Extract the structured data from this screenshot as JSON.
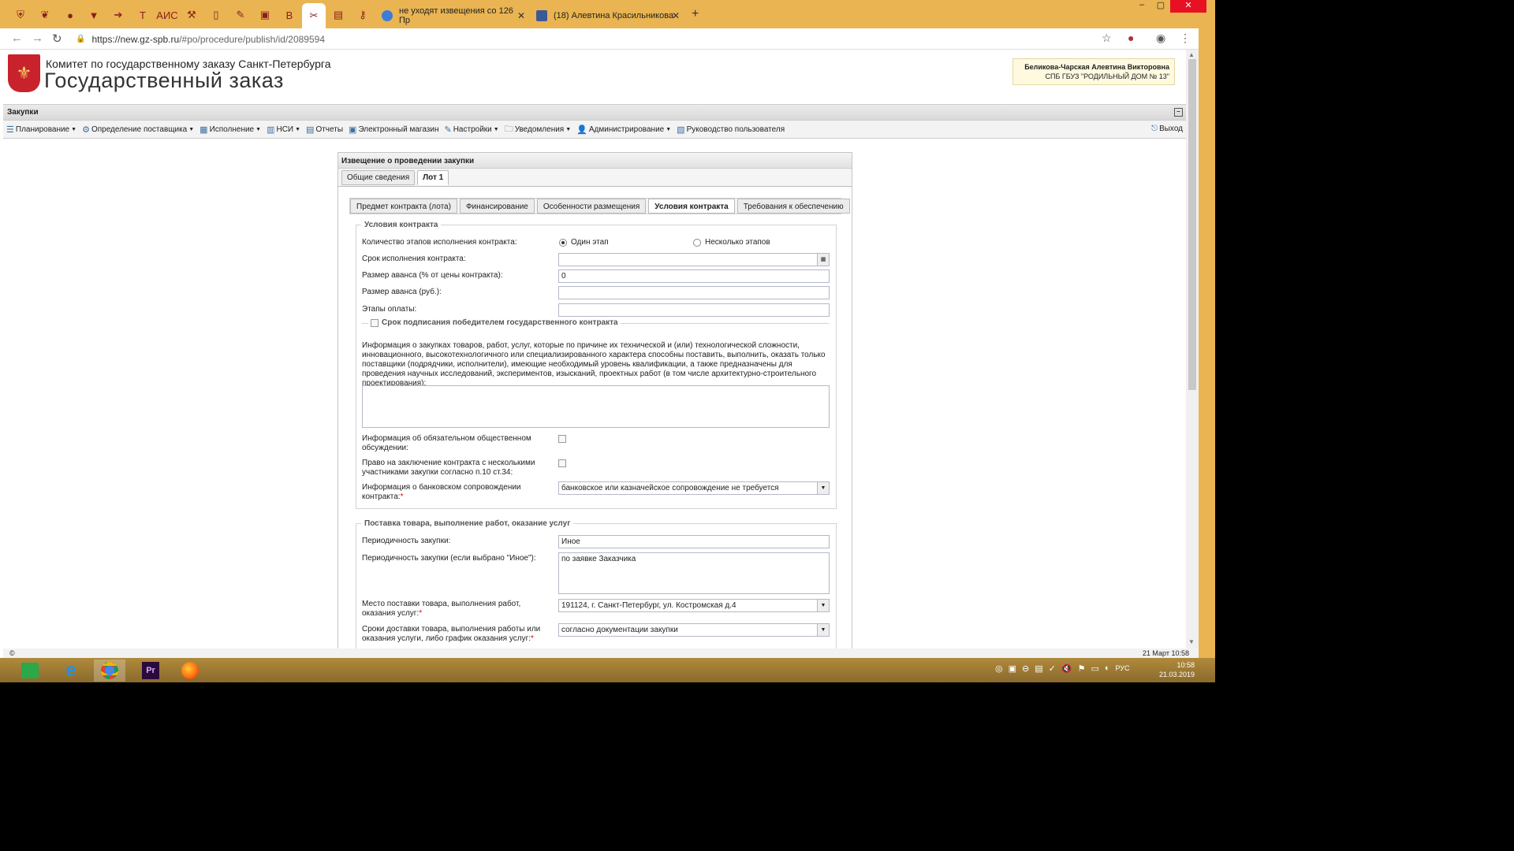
{
  "browser": {
    "pinned_tabs": [
      "flag",
      "leaf",
      "circle",
      "ribbon",
      "arrow",
      "T",
      "АИС",
      "tool",
      "doc",
      "pen",
      "bus",
      "B",
      "scissors",
      "card",
      "key"
    ],
    "tabs": [
      {
        "title": "не уходят извещения со 126 Пр",
        "favicon": "#3b7dd8"
      },
      {
        "title": "(18) Алевтина Красильникова",
        "favicon": "#3b5998"
      }
    ],
    "new_tab": "+",
    "url_host": "https://new.gz-spb.ru",
    "url_path": "/#po/procedure/publish/id/2089594"
  },
  "header": {
    "org": "Комитет по государственному заказу Санкт-Петербурга",
    "title": "Государственный заказ",
    "user_name": "Беликова-Чарская Алевтина Викторовна",
    "user_org": "СПБ ГБУЗ \"РОДИЛЬНЫЙ ДОМ № 13\""
  },
  "section_title": "Закупки",
  "menu": [
    {
      "label": "Планирование",
      "dropdown": true
    },
    {
      "label": "Определение поставщика",
      "dropdown": true
    },
    {
      "label": "Исполнение",
      "dropdown": true
    },
    {
      "label": "НСИ",
      "dropdown": true
    },
    {
      "label": "Отчеты",
      "dropdown": false
    },
    {
      "label": "Электронный магазин",
      "dropdown": false
    },
    {
      "label": "Настройки",
      "dropdown": true
    },
    {
      "label": "Уведомления",
      "dropdown": true
    },
    {
      "label": "Администрирование",
      "dropdown": true
    },
    {
      "label": "Руководство пользователя",
      "dropdown": false
    }
  ],
  "logout": "Выход",
  "panel": {
    "title": "Извещение о проведении закупки",
    "tabs": [
      "Общие сведения",
      "Лот 1"
    ],
    "subtabs": [
      "Предмет контракта (лота)",
      "Финансирование",
      "Особенности размещения",
      "Условия контракта",
      "Требования к обеспечению"
    ],
    "fs1": {
      "legend": "Условия контракта",
      "stages_label": "Количество этапов исполнения контракта:",
      "radio_one": "Один этап",
      "radio_many": "Несколько этапов",
      "term_label": "Срок исполнения контракта:",
      "term_value": "",
      "advance_pct_label": "Размер аванса (% от цены контракта):",
      "advance_pct_value": "0",
      "advance_rub_label": "Размер аванса (руб.):",
      "advance_rub_value": "",
      "payment_label": "Этапы оплаты:",
      "payment_value": "",
      "signing_legend": "Срок подписания победителем государственного контракта",
      "info_label": "Информация о закупках товаров, работ, услуг, которые по причине их технической и (или) технологической сложности, инновационного, высокотехнологичного или специализированного характера способны поставить, выполнить, оказать только поставщики (подрядчики, исполнители), имеющие необходимый уровень квалификации, а также предназначены для проведения научных исследований, экспериментов, изысканий, проектных работ (в том числе архитектурно-строительного проектирования):",
      "public_label": "Информация об обязательном общественном обсуждении:",
      "multi_label": "Право на заключение контракта с несколькими участниками закупки согласно п.10 ст.34:",
      "bank_label": "Информация о банковском сопровождении контракта:",
      "bank_value": "банковское или казначейское сопровождение не требуется"
    },
    "fs2": {
      "legend": "Поставка товара, выполнение работ, оказание услуг",
      "period_label": "Периодичность закупки:",
      "period_value": "Иное",
      "period_other_label": "Периодичность закупки (если выбрано \"Иное\"):",
      "period_other_value": "по заявке Заказчика",
      "place_label": "Место поставки товара, выполнения работ, оказания услуг:",
      "place_value": "191124, г. Санкт-Петербург, ул. Костромская д.4",
      "terms_label": "Сроки доставки товара, выполнения работы или оказания услуги, либо график оказания услуг:",
      "terms_value": "согласно документации закупки"
    }
  },
  "statusbar": {
    "left": "©",
    "date": "21 Март 10:58"
  },
  "taskbar": {
    "lang": "РУС",
    "time": "10:58",
    "date": "21.03.2019"
  }
}
